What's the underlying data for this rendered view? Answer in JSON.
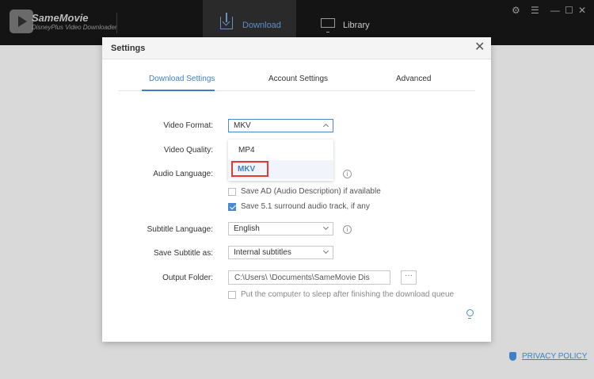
{
  "app": {
    "name": "SameMovie",
    "subtitle": "DisneyPlus Video Downloader"
  },
  "nav": {
    "download_label": "Download",
    "library_label": "Library"
  },
  "window_controls": {
    "settings_glyph": "⚙",
    "menu_glyph": "☰",
    "minimize_glyph": "—",
    "maximize_glyph": "☐",
    "close_glyph": "✕"
  },
  "dialog": {
    "title": "Settings",
    "close_glyph": "✕",
    "tabs": [
      "Download Settings",
      "Account Settings",
      "Advanced"
    ],
    "active_tab": "Download Settings",
    "fields": {
      "video_format": {
        "label": "Video Format:",
        "value": "MKV"
      },
      "video_quality": {
        "label": "Video Quality:"
      },
      "audio_language": {
        "label": "Audio Language:"
      },
      "save_ad": {
        "label": "Save AD (Audio Description) if available",
        "checked": false
      },
      "save_51": {
        "label": "Save 5.1 surround audio track, if any",
        "checked": true
      },
      "subtitle_language": {
        "label": "Subtitle Language:",
        "value": "English"
      },
      "save_subtitle_as": {
        "label": "Save Subtitle as:",
        "value": "Internal subtitles"
      },
      "output_folder": {
        "label": "Output Folder:",
        "value": "C:\\Users\\            \\Documents\\SameMovie Dis",
        "browse_label": "···"
      },
      "sleep_after": {
        "label": "Put the computer to sleep after finishing the download queue",
        "checked": false
      }
    },
    "video_format_options": [
      "MP4",
      "MKV"
    ],
    "info_glyph": "i"
  },
  "footer": {
    "privacy_label": "PRIVACY POLICY"
  },
  "colors": {
    "accent": "#3f7fc8",
    "highlight_box": "#e53935",
    "topbar": "#141414"
  },
  "icons": [
    "logo-icon",
    "download-icon",
    "library-icon",
    "gear-icon",
    "menu-icon",
    "info-icon",
    "bulb-icon",
    "shield-icon"
  ]
}
